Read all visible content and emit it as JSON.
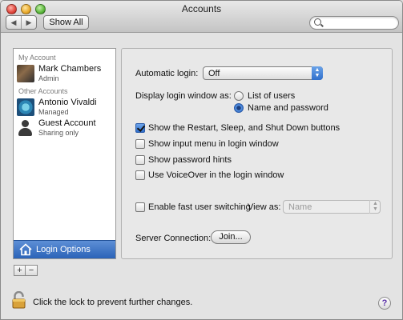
{
  "window": {
    "title": "Accounts"
  },
  "toolbar": {
    "back_glyph": "◀",
    "forward_glyph": "▶",
    "show_all_label": "Show All",
    "search_placeholder": ""
  },
  "sidebar": {
    "my_account_header": "My Account",
    "other_accounts_header": "Other Accounts",
    "accounts": [
      {
        "name": "Mark Chambers",
        "role": "Admin",
        "avatar": "user-photo"
      },
      {
        "name": "Antonio Vivaldi",
        "role": "Managed",
        "avatar": "user-photo"
      },
      {
        "name": "Guest Account",
        "role": "Sharing only",
        "avatar": "person-silhouette-icon"
      }
    ],
    "login_options_label": "Login Options",
    "add_glyph": "+",
    "remove_glyph": "−",
    "selected_color": "#2b63b8"
  },
  "main": {
    "automatic_login_label": "Automatic login:",
    "automatic_login_value": "Off",
    "display_login_label": "Display login window as:",
    "display_options": [
      {
        "label": "List of users",
        "selected": false
      },
      {
        "label": "Name and password",
        "selected": true
      }
    ],
    "checkboxes": [
      {
        "label": "Show the Restart, Sleep, and Shut Down buttons",
        "checked": true
      },
      {
        "label": "Show input menu in login window",
        "checked": false
      },
      {
        "label": "Show password hints",
        "checked": false
      },
      {
        "label": "Use VoiceOver in the login window",
        "checked": false
      }
    ],
    "fast_switching_label": "Enable fast user switching",
    "fast_switching_checked": false,
    "view_as_label": "View as:",
    "view_as_value": "Name",
    "server_connection_label": "Server Connection:",
    "join_label": "Join..."
  },
  "footer": {
    "lock_text": "Click the lock to prevent further changes.",
    "help_glyph": "?"
  }
}
